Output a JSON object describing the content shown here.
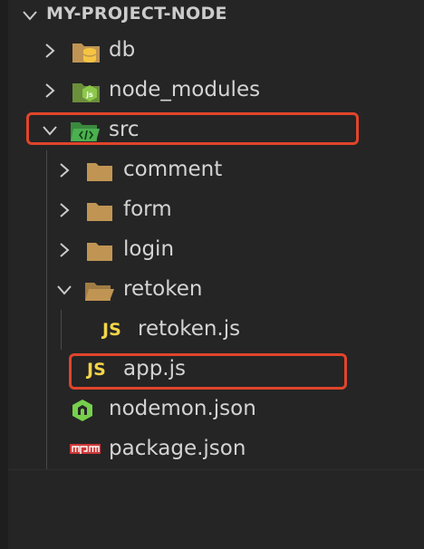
{
  "explorer": {
    "project_title": "MY-PROJECT-NODE",
    "items": [
      {
        "label": "db",
        "icon": "database-folder-icon",
        "state": "collapsed"
      },
      {
        "label": "node_modules",
        "icon": "node-modules-folder-icon",
        "state": "collapsed"
      },
      {
        "label": "src",
        "icon": "src-folder-icon",
        "state": "expanded"
      },
      {
        "label": "comment",
        "icon": "folder-icon",
        "state": "collapsed"
      },
      {
        "label": "form",
        "icon": "folder-icon",
        "state": "collapsed"
      },
      {
        "label": "login",
        "icon": "folder-icon",
        "state": "collapsed"
      },
      {
        "label": "retoken",
        "icon": "folder-open-icon",
        "state": "expanded"
      },
      {
        "label": "retoken.js",
        "icon": "javascript-file-icon"
      },
      {
        "label": "app.js",
        "icon": "javascript-file-icon"
      },
      {
        "label": "nodemon.json",
        "icon": "nodemon-icon"
      },
      {
        "label": "package.json",
        "icon": "npm-icon"
      }
    ],
    "js_badge": "JS"
  },
  "colors": {
    "background": "#252526",
    "text": "#d4d4d4",
    "highlight_border": "#e0452b",
    "folder": "#c09553",
    "js_yellow": "#f3d548",
    "node_green": "#8cc84b",
    "npm_red": "#cb3837"
  },
  "highlighted_items": [
    "src",
    "app.js"
  ]
}
